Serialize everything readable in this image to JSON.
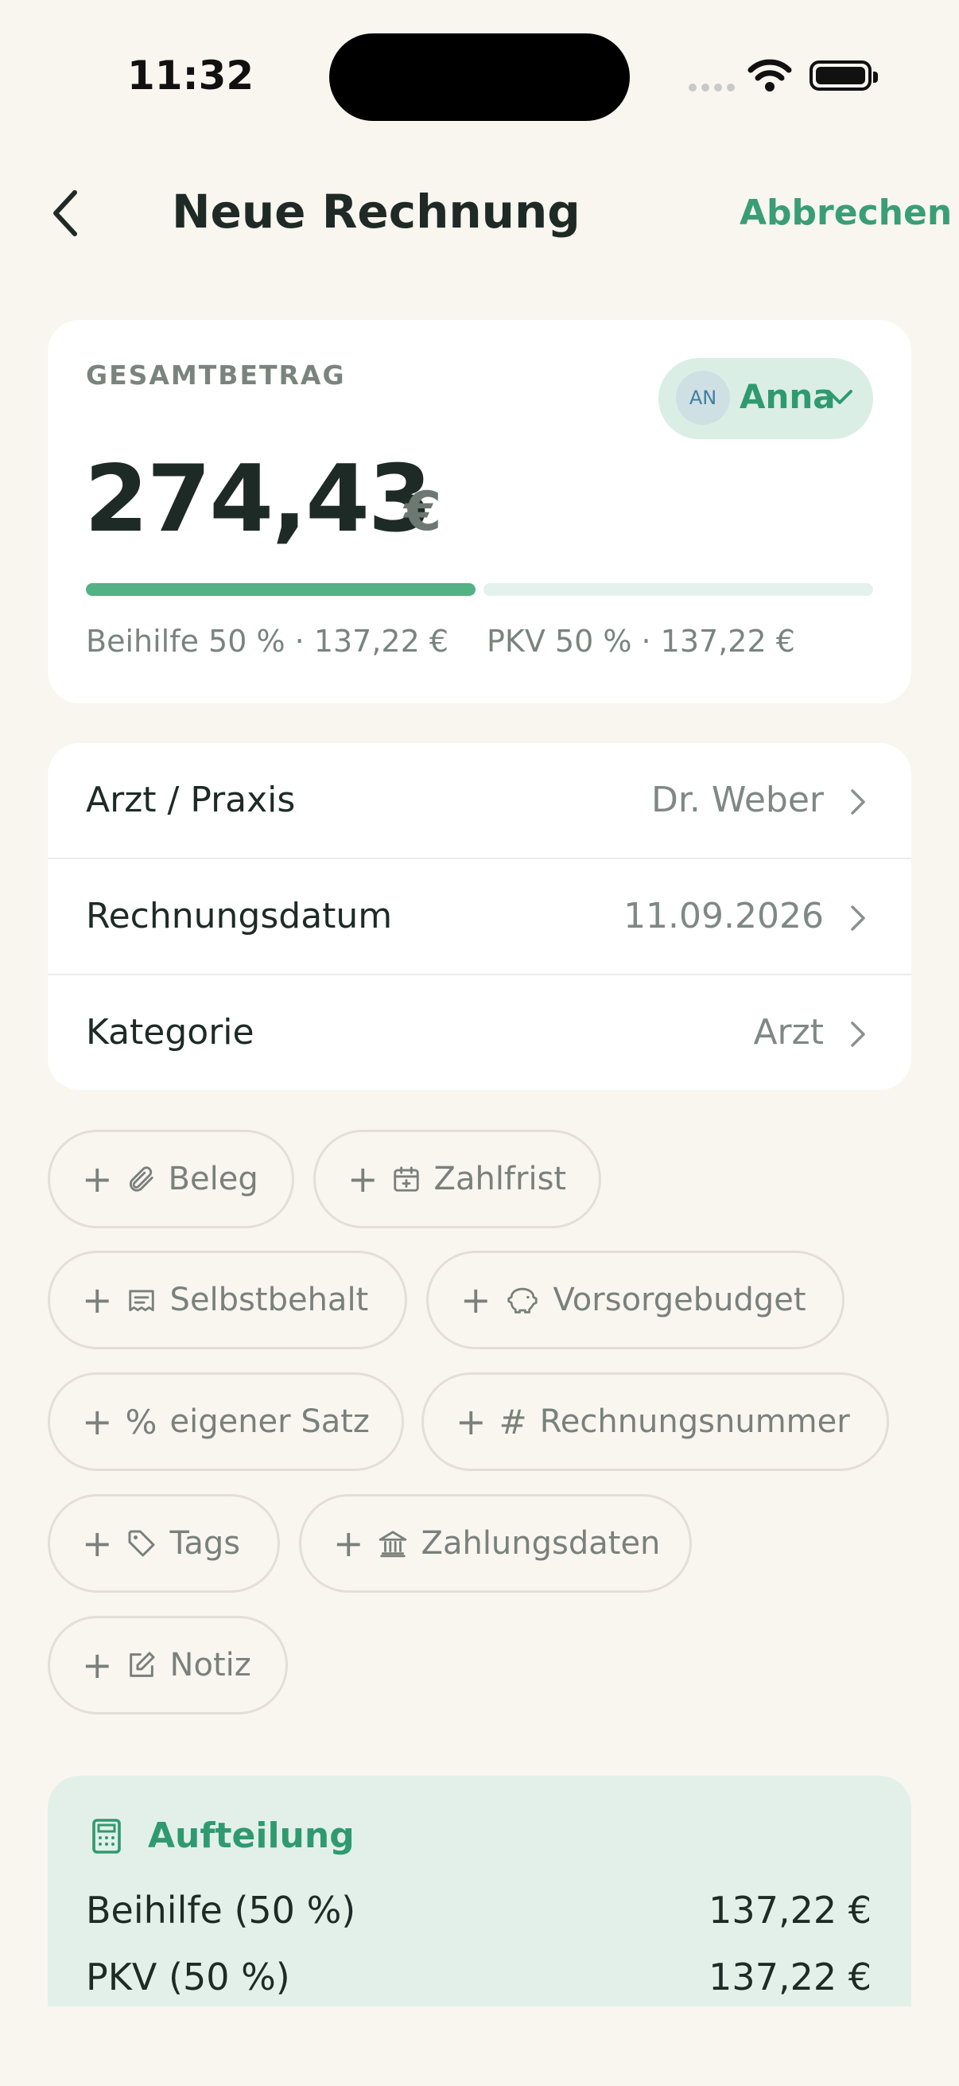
{
  "status_bar": {
    "time": "11:32"
  },
  "nav": {
    "title": "Neue Rechnung",
    "cancel_label": "Abbrechen"
  },
  "total": {
    "label": "GESAMTBETRAG",
    "amount": "274,43",
    "currency": "€",
    "person_initials": "AN",
    "person_name": "Anna",
    "split_beihilfe": "Beihilfe 50 % · 137,22 €",
    "split_pkv": "PKV 50 % · 137,22 €",
    "beihilfe_share": 0.5
  },
  "fields": [
    {
      "label": "Arzt / Praxis",
      "value": "Dr. Weber"
    },
    {
      "label": "Rechnungsdatum",
      "value": "11.09.2026"
    },
    {
      "label": "Kategorie",
      "value": "Arzt"
    }
  ],
  "chips": {
    "beleg": "Beleg",
    "zahlfrist": "Zahlfrist",
    "selbstbehalt": "Selbstbehalt",
    "vorsorgebudget": "Vorsorgebudget",
    "eigener_satz": "eigener Satz",
    "rechnungsnummer": "Rechnungsnummer",
    "tags": "Tags",
    "zahlungsdaten": "Zahlungsdaten",
    "notiz": "Notiz"
  },
  "split_section": {
    "title": "Aufteilung",
    "rows": [
      {
        "label": "Beihilfe (50 %)",
        "value": "137,22 €"
      },
      {
        "label": "PKV (50 %)",
        "value": "137,22 €"
      }
    ]
  },
  "colors": {
    "accent": "#2f9a6f",
    "background": "#f9f6f0",
    "bar_fill": "#53b285"
  }
}
